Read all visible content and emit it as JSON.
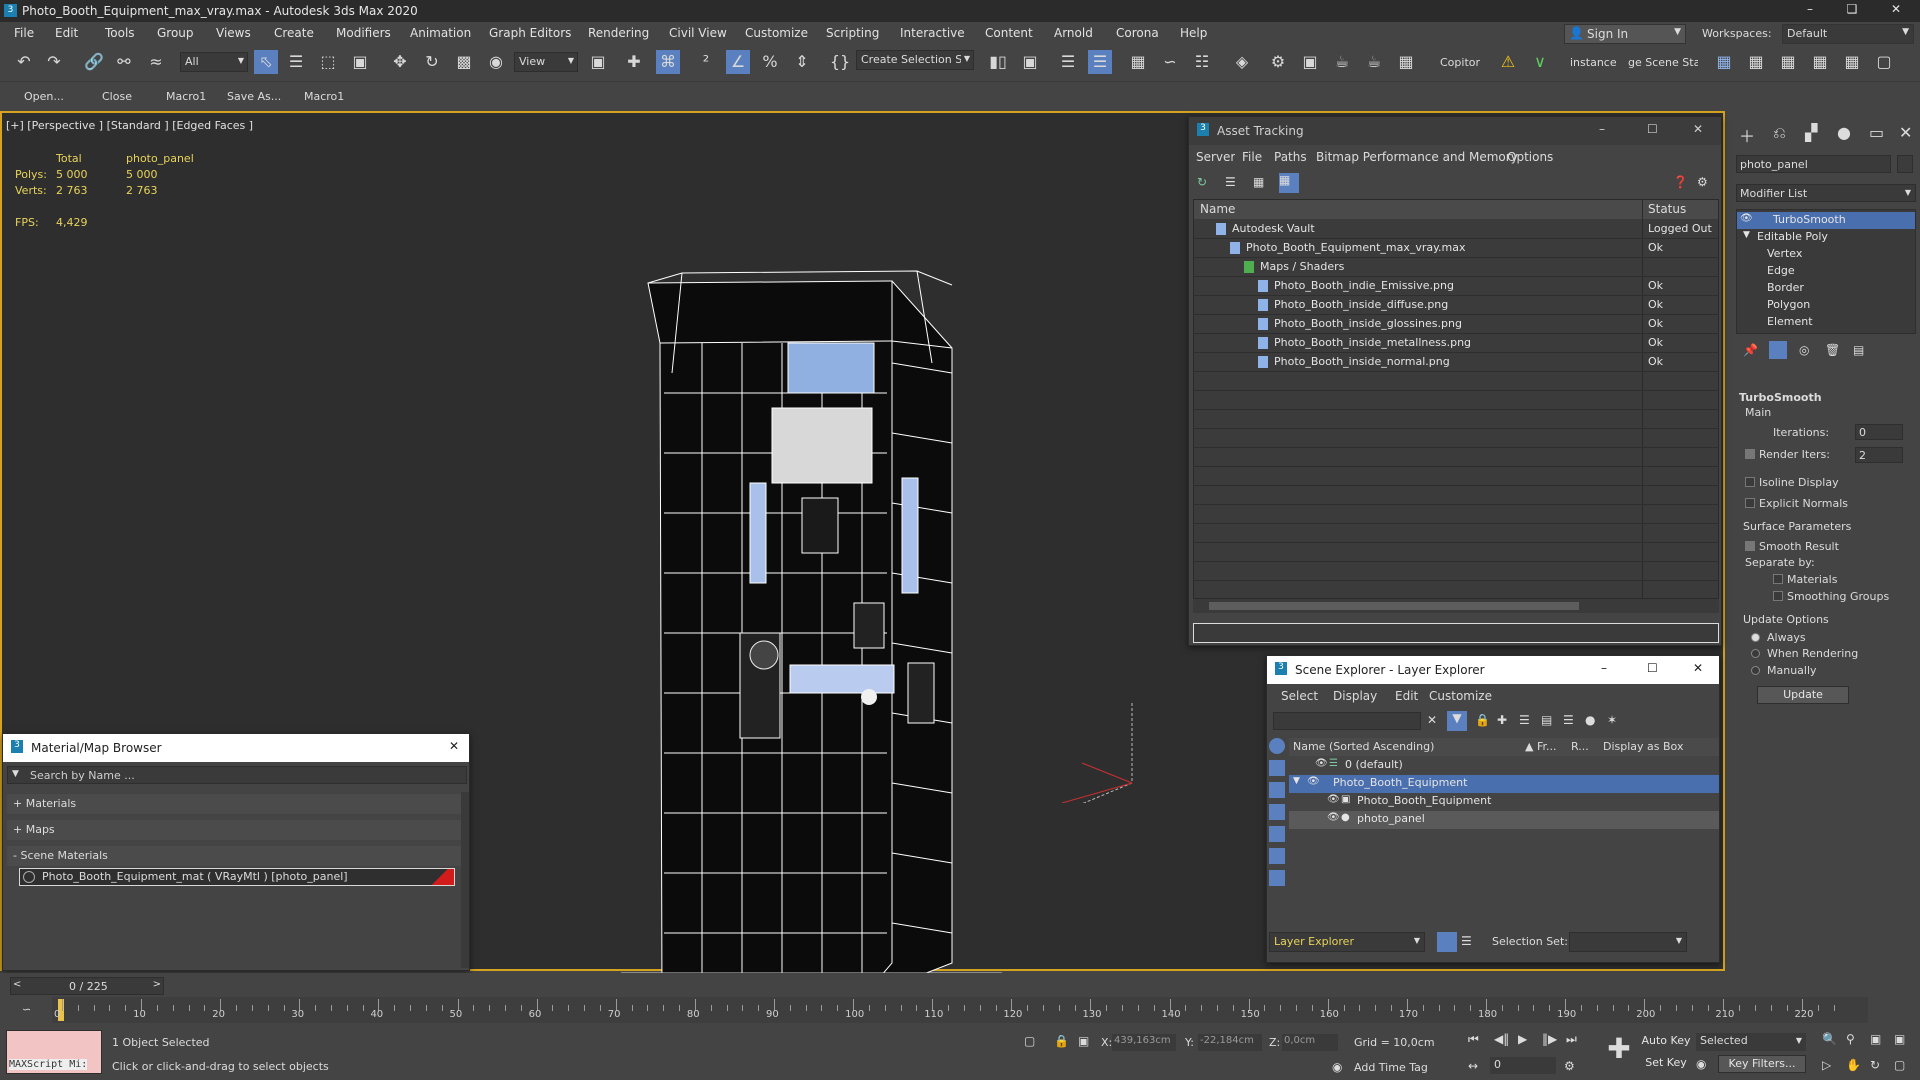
{
  "window_title": "Photo_Booth_Equipment_max_vray.max - Autodesk 3ds Max 2020",
  "menus": [
    "File",
    "Edit",
    "Tools",
    "Group",
    "Views",
    "Create",
    "Modifiers",
    "Animation",
    "Graph Editors",
    "Rendering",
    "Civil View",
    "Customize",
    "Scripting",
    "Interactive",
    "Content",
    "Arnold",
    "Corona",
    "Help"
  ],
  "sign_in": "Sign In",
  "workspaces_label": "Workspaces:",
  "workspaces_value": "Default",
  "toolbar": {
    "filter": "All",
    "view": "View",
    "selection_set": "Create Selection Se",
    "copitor": "Copitor",
    "instance": "instance",
    "scene_stat": "ge Scene Stat"
  },
  "toolbar2": [
    "Open...",
    "Close",
    "Macro1",
    "Save As...",
    "Macro1"
  ],
  "viewport": {
    "label": "[+] [Perspective ] [Standard ] [Edged Faces ]",
    "stats": {
      "total": "Total",
      "object": "photo_panel",
      "polys_label": "Polys:",
      "polys_total": "5 000",
      "polys_obj": "5 000",
      "verts_label": "Verts:",
      "verts_total": "2 763",
      "verts_obj": "2 763",
      "fps_label": "FPS:",
      "fps": "4,429"
    }
  },
  "asset_tracking": {
    "title": "Asset Tracking",
    "menus": [
      "Server",
      "File",
      "Paths",
      "Bitmap Performance and Memory",
      "Options"
    ],
    "col_name": "Name",
    "col_status": "Status",
    "rows": [
      {
        "name": "Autodesk Vault",
        "status": "Logged Out ."
      },
      {
        "name": "Photo_Booth_Equipment_max_vray.max",
        "status": "Ok"
      },
      {
        "name": "Maps / Shaders",
        "status": ""
      },
      {
        "name": "Photo_Booth_indie_Emissive.png",
        "status": "Ok"
      },
      {
        "name": "Photo_Booth_inside_diffuse.png",
        "status": "Ok"
      },
      {
        "name": "Photo_Booth_inside_glossines.png",
        "status": "Ok"
      },
      {
        "name": "Photo_Booth_inside_metallness.png",
        "status": "Ok"
      },
      {
        "name": "Photo_Booth_inside_normal.png",
        "status": "Ok"
      }
    ]
  },
  "material_browser": {
    "title": "Material/Map Browser",
    "search": "Search by Name ...",
    "materials": "+ Materials",
    "maps": "+ Maps",
    "scene_materials": "- Scene Materials",
    "item": "Photo_Booth_Equipment_mat  ( VRayMtl ) [photo_panel]"
  },
  "scene_explorer": {
    "title": "Scene Explorer - Layer Explorer",
    "menus": [
      "Select",
      "Display",
      "Edit",
      "Customize"
    ],
    "col_name": "Name (Sorted Ascending)",
    "col_fr": "▲ Fr...",
    "col_r": "R...",
    "col_box": "Display as Box",
    "rows": [
      {
        "name": "0 (default)"
      },
      {
        "name": "Photo_Booth_Equipment"
      },
      {
        "name": "Photo_Booth_Equipment"
      },
      {
        "name": "photo_panel"
      }
    ],
    "footer_left": "Layer Explorer",
    "selection_set": "Selection Set:"
  },
  "command_panel": {
    "object_name": "photo_panel",
    "modifier_list": "Modifier List",
    "stack": [
      "TurboSmooth",
      "Editable Poly",
      "Vertex",
      "Edge",
      "Border",
      "Polygon",
      "Element"
    ],
    "rollout": "TurboSmooth",
    "main": "Main",
    "iterations_label": "Iterations:",
    "iterations": "0",
    "render_iters_label": "Render Iters:",
    "render_iters": "2",
    "isoline": "Isoline Display",
    "explicit_normals": "Explicit Normals",
    "surface_params": "Surface Parameters",
    "smooth_result": "Smooth Result",
    "separate_by": "Separate by:",
    "materials": "Materials",
    "smoothing_groups": "Smoothing Groups",
    "update_options": "Update Options",
    "always": "Always",
    "when_rendering": "When Rendering",
    "manually": "Manually",
    "update": "Update"
  },
  "timeline": {
    "frame": "0 / 225",
    "ticks": [
      "0",
      "10",
      "20",
      "30",
      "40",
      "50",
      "60",
      "70",
      "80",
      "90",
      "100",
      "110",
      "120",
      "130",
      "140",
      "150",
      "160",
      "170",
      "180",
      "190",
      "200",
      "210",
      "220"
    ]
  },
  "status": {
    "maxscript": "MAXScript Mi:",
    "selected": "1 Object Selected",
    "hint": "Click or click-and-drag to select objects",
    "x_label": "X:",
    "x": "439,163cm",
    "y_label": "Y:",
    "y": "-22,184cm",
    "z_label": "Z:",
    "z": "0,0cm",
    "grid": "Grid = 10,0cm",
    "add_time_tag": "Add Time Tag",
    "auto_key": "Auto Key",
    "set_key": "Set Key",
    "selected_dd": "Selected",
    "key_filters": "Key Filters...",
    "frame_field": "0"
  }
}
